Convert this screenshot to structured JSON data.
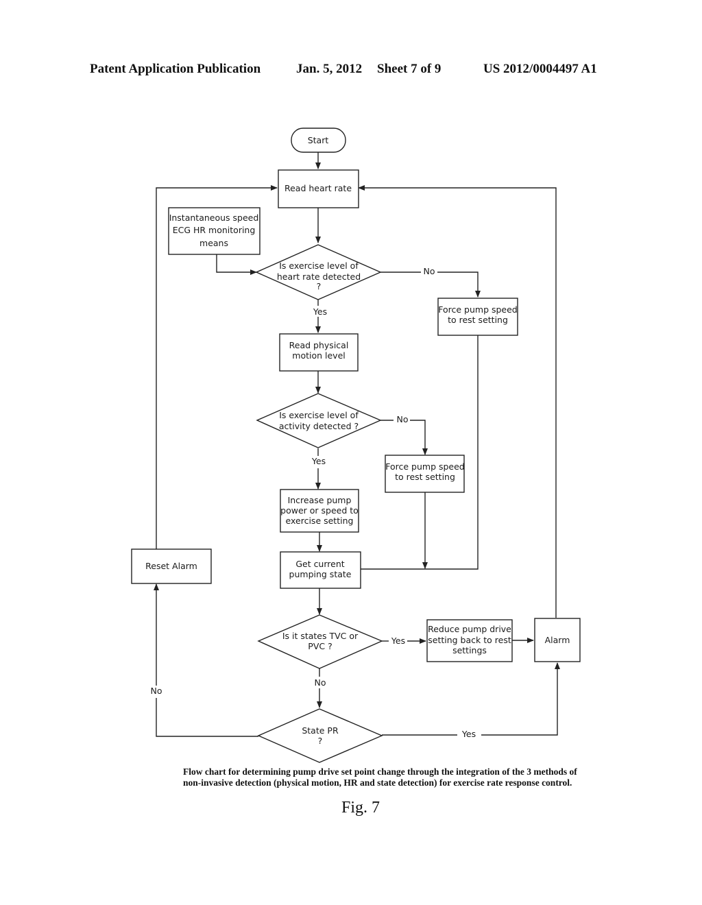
{
  "header": {
    "publication": "Patent Application Publication",
    "date": "Jan. 5, 2012",
    "sheet": "Sheet 7 of 9",
    "number": "US 2012/0004497 A1"
  },
  "flowchart": {
    "start": "Start",
    "read_heart_rate": "Read heart rate",
    "ecg_monitor": [
      "Instantaneous speed",
      "ECG HR monitoring",
      "means"
    ],
    "decision_hr": [
      "Is exercise level of",
      "heart rate detected",
      "?"
    ],
    "force_rest_1": [
      "Force pump speed",
      "to rest setting"
    ],
    "read_motion": [
      "Read physical",
      "motion level"
    ],
    "decision_activity": [
      "Is exercise level of",
      "activity detected ?"
    ],
    "force_rest_2": [
      "Force pump speed",
      "to rest setting"
    ],
    "increase_pump": [
      "Increase pump",
      "power or speed to",
      "exercise setting"
    ],
    "get_state": [
      "Get current",
      "pumping state"
    ],
    "decision_tvc": [
      "Is it states TVC or",
      "PVC ?"
    ],
    "reduce_pump": [
      "Reduce pump drive",
      "setting back to rest",
      "settings"
    ],
    "alarm": "Alarm",
    "reset_alarm": "Reset Alarm",
    "decision_pr": [
      "State PR",
      "?"
    ],
    "labels": {
      "hr_no": "No",
      "hr_yes": "Yes",
      "activity_no": "No",
      "activity_yes": "Yes",
      "tvc_yes": "Yes",
      "tvc_no": "No",
      "pr_yes": "Yes",
      "pr_no": "No"
    }
  },
  "caption": "Flow chart for determining pump drive set point change through the integration of the 3 methods of non-invasive detection (physical motion, HR and state detection) for exercise rate response control.",
  "figure_label": "Fig. 7"
}
